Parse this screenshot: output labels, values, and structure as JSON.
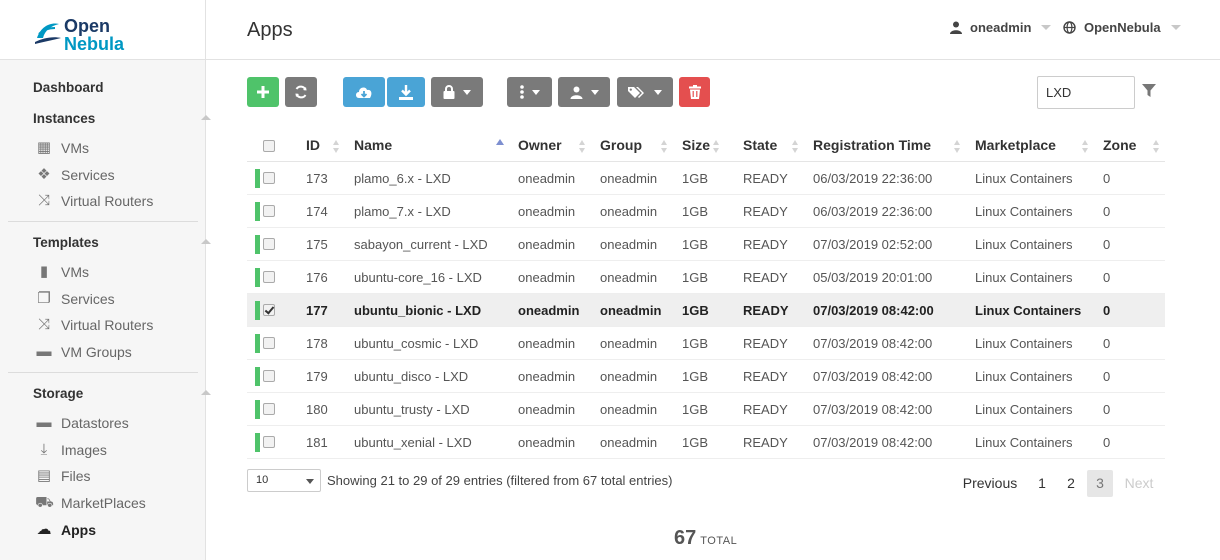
{
  "app": {
    "logo_line1": "Open",
    "logo_line2": "Nebula",
    "page_title": "Apps"
  },
  "header": {
    "user": "oneadmin",
    "zone": "OpenNebula"
  },
  "sidebar": {
    "dashboard": "Dashboard",
    "instances": {
      "label": "Instances",
      "items": [
        "VMs",
        "Services",
        "Virtual Routers"
      ]
    },
    "templates": {
      "label": "Templates",
      "items": [
        "VMs",
        "Services",
        "Virtual Routers",
        "VM Groups"
      ]
    },
    "storage": {
      "label": "Storage",
      "items": [
        "Datastores",
        "Images",
        "Files",
        "MarketPlaces",
        "Apps"
      ]
    },
    "active_item": "Apps"
  },
  "toolbar": {
    "search_value": "LXD"
  },
  "table": {
    "columns": [
      "ID",
      "Name",
      "Owner",
      "Group",
      "Size",
      "State",
      "Registration Time",
      "Marketplace",
      "Zone"
    ],
    "rows": [
      {
        "id": "173",
        "name": "plamo_6.x - LXD",
        "owner": "oneadmin",
        "group": "oneadmin",
        "size": "1GB",
        "state": "READY",
        "time": "06/03/2019 22:36:00",
        "market": "Linux Containers",
        "zone": "0",
        "selected": false
      },
      {
        "id": "174",
        "name": "plamo_7.x - LXD",
        "owner": "oneadmin",
        "group": "oneadmin",
        "size": "1GB",
        "state": "READY",
        "time": "06/03/2019 22:36:00",
        "market": "Linux Containers",
        "zone": "0",
        "selected": false
      },
      {
        "id": "175",
        "name": "sabayon_current - LXD",
        "owner": "oneadmin",
        "group": "oneadmin",
        "size": "1GB",
        "state": "READY",
        "time": "07/03/2019 02:52:00",
        "market": "Linux Containers",
        "zone": "0",
        "selected": false
      },
      {
        "id": "176",
        "name": "ubuntu-core_16 - LXD",
        "owner": "oneadmin",
        "group": "oneadmin",
        "size": "1GB",
        "state": "READY",
        "time": "05/03/2019 20:01:00",
        "market": "Linux Containers",
        "zone": "0",
        "selected": false
      },
      {
        "id": "177",
        "name": "ubuntu_bionic - LXD",
        "owner": "oneadmin",
        "group": "oneadmin",
        "size": "1GB",
        "state": "READY",
        "time": "07/03/2019 08:42:00",
        "market": "Linux Containers",
        "zone": "0",
        "selected": true
      },
      {
        "id": "178",
        "name": "ubuntu_cosmic - LXD",
        "owner": "oneadmin",
        "group": "oneadmin",
        "size": "1GB",
        "state": "READY",
        "time": "07/03/2019 08:42:00",
        "market": "Linux Containers",
        "zone": "0",
        "selected": false
      },
      {
        "id": "179",
        "name": "ubuntu_disco - LXD",
        "owner": "oneadmin",
        "group": "oneadmin",
        "size": "1GB",
        "state": "READY",
        "time": "07/03/2019 08:42:00",
        "market": "Linux Containers",
        "zone": "0",
        "selected": false
      },
      {
        "id": "180",
        "name": "ubuntu_trusty - LXD",
        "owner": "oneadmin",
        "group": "oneadmin",
        "size": "1GB",
        "state": "READY",
        "time": "07/03/2019 08:42:00",
        "market": "Linux Containers",
        "zone": "0",
        "selected": false
      },
      {
        "id": "181",
        "name": "ubuntu_xenial - LXD",
        "owner": "oneadmin",
        "group": "oneadmin",
        "size": "1GB",
        "state": "READY",
        "time": "07/03/2019 08:42:00",
        "market": "Linux Containers",
        "zone": "0",
        "selected": false
      }
    ]
  },
  "footer": {
    "page_size": "10",
    "info": "Showing 21 to 29 of 29 entries (filtered from 67 total entries)",
    "previous": "Previous",
    "pages": [
      "1",
      "2",
      "3"
    ],
    "current_page": "3",
    "next": "Next",
    "total_count": "67",
    "total_label": "TOTAL"
  },
  "colors": {
    "green": "#4fc36a",
    "blue": "#4aa4d6",
    "grey": "#7a7a7a",
    "red": "#e44f4f"
  }
}
